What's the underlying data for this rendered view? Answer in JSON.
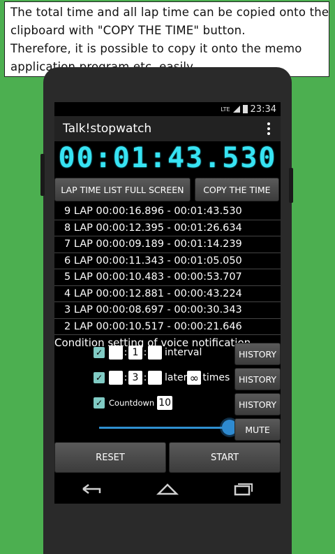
{
  "caption": {
    "line1": "The total time and all lap time can be copied onto the",
    "line2": "clipboard with \"COPY THE TIME\" button.",
    "line3": "Therefore, it is possible to copy it onto the memo",
    "line4": "application program etc. easily."
  },
  "status_bar": {
    "network": "LTE",
    "time": "23:34"
  },
  "app": {
    "title": "Talk!stopwatch"
  },
  "timer": {
    "main": "00:01:43",
    "ms": ".530"
  },
  "buttons": {
    "lap_list": "LAP TIME LIST FULL SCREEN",
    "copy": "COPY THE TIME",
    "history": "HISTORY",
    "mute": "MUTE",
    "reset": "RESET",
    "start": "START"
  },
  "laps": [
    "9 LAP 00:00:16.896 - 00:01:43.530",
    "8 LAP 00:00:12.395 - 00:01:26.634",
    "7 LAP 00:00:09.189 - 00:01:14.239",
    "6 LAP 00:00:11.343 - 00:01:05.050",
    "5 LAP 00:00:10.483 - 00:00:53.707",
    "4 LAP 00:00:12.881 - 00:00:43.224",
    "3 LAP 00:00:08.697 - 00:00:30.343",
    "2 LAP 00:00:10.517 - 00:00:21.646"
  ],
  "voice": {
    "title": "Condition setting of voice notification",
    "interval": {
      "h": "",
      "m": "1",
      "s": "",
      "label": "interval"
    },
    "later": {
      "h": "",
      "m": "3",
      "s": "",
      "label": "later",
      "times_value": "∞",
      "times_label": "times"
    },
    "countdown": {
      "label": "Countdown",
      "value": "10"
    },
    "colon": ":",
    "check": "✓"
  },
  "volume_level": 0.93,
  "icons": [
    "back-icon",
    "home-icon",
    "recents-icon",
    "overflow-menu-icon",
    "signal-icon",
    "battery-icon"
  ]
}
